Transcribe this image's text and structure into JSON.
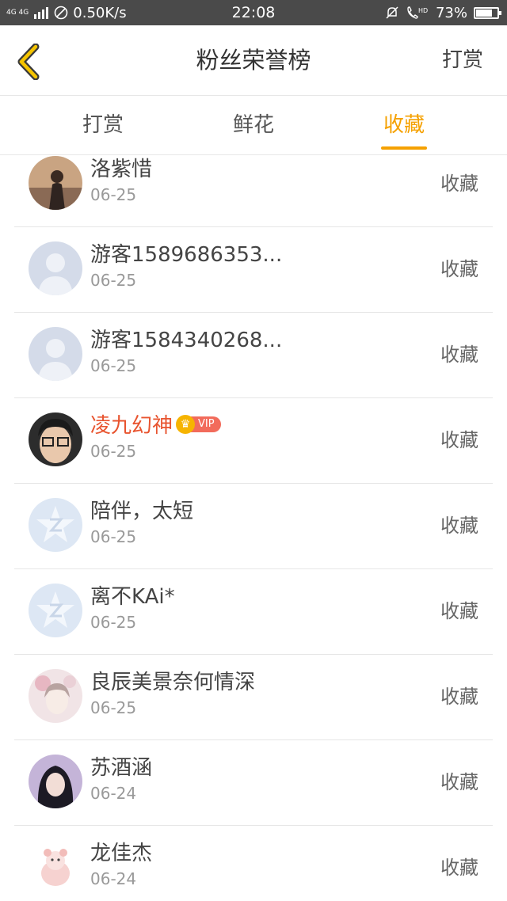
{
  "status_bar": {
    "network": "4G 4G",
    "speed": "0.50K/s",
    "time": "22:08",
    "hd": "HD",
    "battery": "73%",
    "battery_level": 0.73
  },
  "header": {
    "title": "粉丝荣誉榜",
    "right_action": "打赏"
  },
  "tabs": [
    {
      "label": "打赏",
      "active": false
    },
    {
      "label": "鲜花",
      "active": false
    },
    {
      "label": "收藏",
      "active": true
    }
  ],
  "colors": {
    "accent": "#f5a100",
    "vip_name": "#e8542f",
    "status_bar_bg": "#4a4a4a"
  },
  "fans": [
    {
      "name": "洛紫惜",
      "date": "06-25",
      "action": "收藏",
      "avatar": "photo-avatar"
    },
    {
      "name": "游客1589686353...",
      "date": "06-25",
      "action": "收藏",
      "avatar": "default-user-avatar"
    },
    {
      "name": "游客1584340268...",
      "date": "06-25",
      "action": "收藏",
      "avatar": "default-user-avatar"
    },
    {
      "name": "凌九幻神",
      "date": "06-25",
      "action": "收藏",
      "avatar": "photo-avatar",
      "vip": "VIP"
    },
    {
      "name": "陪伴，太短",
      "date": "06-25",
      "action": "收藏",
      "avatar": "qq-default-avatar"
    },
    {
      "name": "离不KAi*",
      "date": "06-25",
      "action": "收藏",
      "avatar": "qq-default-avatar"
    },
    {
      "name": "良辰美景奈何情深",
      "date": "06-25",
      "action": "收藏",
      "avatar": "photo-avatar"
    },
    {
      "name": "苏酒涵",
      "date": "06-24",
      "action": "收藏",
      "avatar": "photo-avatar"
    },
    {
      "name": "龙佳杰",
      "date": "06-24",
      "action": "收藏",
      "avatar": "cartoon-avatar"
    }
  ]
}
